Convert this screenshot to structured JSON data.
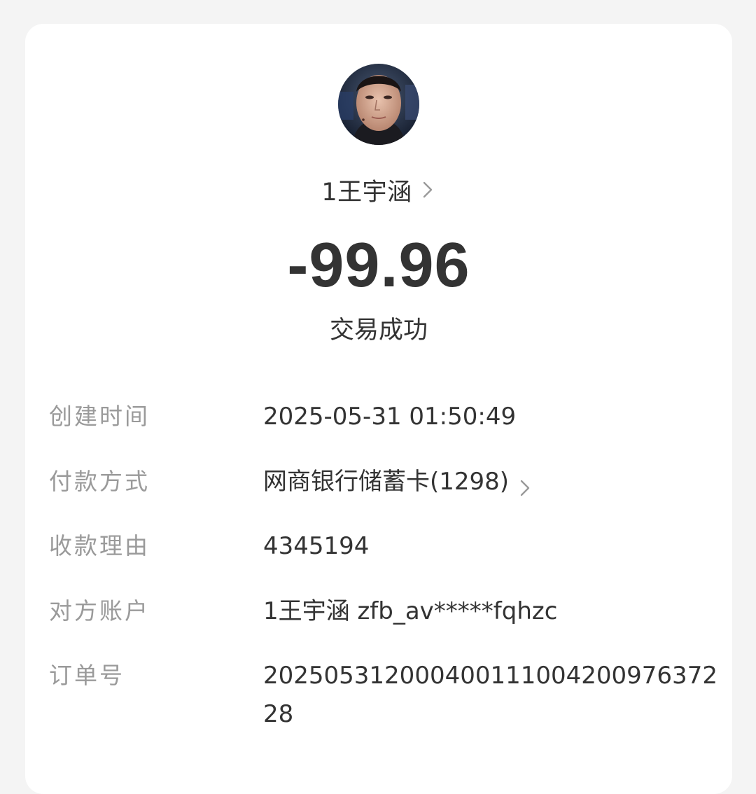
{
  "header": {
    "payee_name": "1王宇涵",
    "amount": "-99.96",
    "status": "交易成功"
  },
  "details": [
    {
      "label": "创建时间",
      "value": "2025-05-31 01:50:49"
    },
    {
      "label": "付款方式",
      "value": "网商银行储蓄卡(1298)"
    },
    {
      "label": "收款理由",
      "value": "4345194"
    },
    {
      "label": "对方账户",
      "value": "1王宇涵 zfb_av*****fqhzc"
    },
    {
      "label": "订单号",
      "value": "20250531200040011100420097637228"
    }
  ],
  "icons": {
    "payee_chevron": "chevron-right-icon",
    "payment_chevron": "chevron-right-icon"
  },
  "colors": {
    "background": "#f4f4f4",
    "card": "#ffffff",
    "primary_text": "#333333",
    "label_text": "#9a9a9a"
  }
}
